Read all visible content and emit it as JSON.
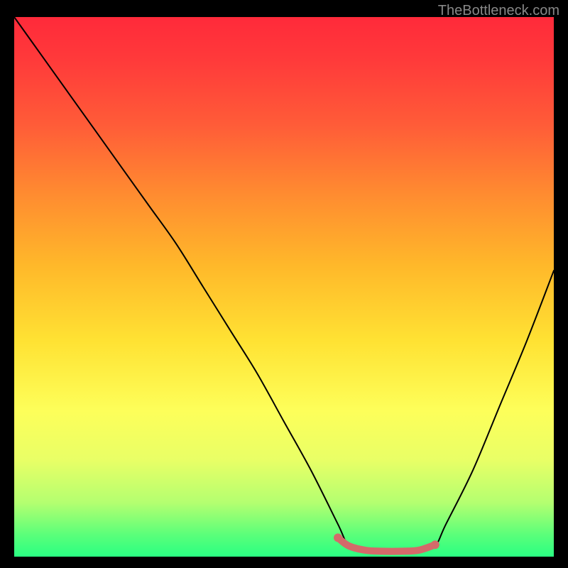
{
  "watermark": "TheBottleneck.com",
  "chart_data": {
    "type": "line",
    "title": "",
    "xlabel": "",
    "ylabel": "",
    "xlim": [
      0,
      100
    ],
    "ylim": [
      0,
      100
    ],
    "grid": false,
    "legend": false,
    "gradient_background": {
      "top_color": "#ff2a3a",
      "bottom_color": "#2aff82",
      "note": "vertical red-to-green gradient inside plot area"
    },
    "series": [
      {
        "name": "bottleneck-curve",
        "color": "#000000",
        "stroke_width": 2,
        "x": [
          0,
          5,
          10,
          15,
          20,
          25,
          30,
          35,
          40,
          45,
          50,
          55,
          60,
          62,
          65,
          70,
          75,
          78,
          80,
          85,
          90,
          95,
          100
        ],
        "values": [
          100,
          93,
          86,
          79,
          72,
          65,
          58,
          50,
          42,
          34,
          25,
          16,
          6,
          2,
          1,
          1,
          1,
          2,
          6,
          16,
          28,
          40,
          53
        ]
      },
      {
        "name": "optimal-marker",
        "color": "#d46a6a",
        "stroke_width": 10,
        "x": [
          60,
          62,
          65,
          68,
          72,
          75,
          78
        ],
        "values": [
          3.5,
          2,
          1.2,
          1,
          1,
          1.2,
          2.2
        ]
      }
    ],
    "annotations": []
  }
}
